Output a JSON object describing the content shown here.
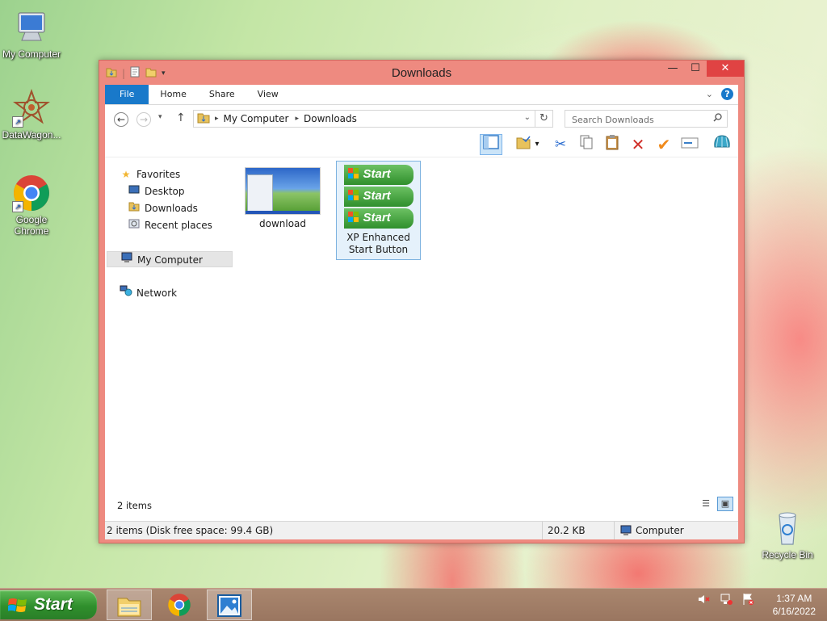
{
  "desktop": {
    "icons": [
      {
        "label": "My Computer"
      },
      {
        "label": "DataWagon..."
      },
      {
        "label": "Google Chrome"
      },
      {
        "label": "Recycle Bin"
      }
    ]
  },
  "window": {
    "title": "Downloads",
    "tabs": [
      "File",
      "Home",
      "Share",
      "View"
    ],
    "address": {
      "crumbs": [
        "My Computer",
        "Downloads"
      ]
    },
    "search": {
      "placeholder": "Search Downloads"
    },
    "nav": {
      "favorites": "Favorites",
      "desktop": "Desktop",
      "downloads": "Downloads",
      "recent": "Recent places",
      "mycomputer": "My Computer",
      "network": "Network"
    },
    "files": [
      {
        "name": "download"
      },
      {
        "name": "XP Enhanced Start Button",
        "thumb_label": "Start"
      }
    ],
    "item_count": "2 items",
    "statusbar": {
      "info": "2 items (Disk free space: 99.4 GB)",
      "size": "20.2 KB",
      "location": "Computer"
    }
  },
  "taskbar": {
    "start_label": "Start",
    "time": "1:37 AM",
    "date": "6/16/2022"
  },
  "colors": {
    "window_frame": "#ee8a80",
    "close_button": "#e04343",
    "file_tab": "#1979ca",
    "start_button": "#2f8f2c",
    "taskbar": "#a9866e"
  }
}
